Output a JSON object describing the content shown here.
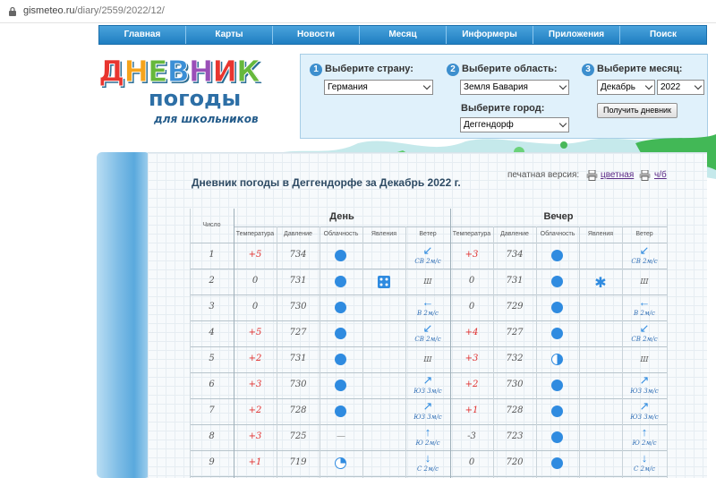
{
  "browser": {
    "url_host": "gismeteo.ru",
    "url_path": "/diary/2559/2022/12/"
  },
  "nav": [
    "Главная",
    "Карты",
    "Новости",
    "Месяц",
    "Информеры",
    "Приложения",
    "Поиск"
  ],
  "logo": {
    "line1": "ДНЕВНИК",
    "line2": "погоды",
    "line3": "для школьников"
  },
  "form": {
    "country_label": "Выберите страну:",
    "country_value": "Германия",
    "region_label": "Выберите область:",
    "region_value": "Земля Бавария",
    "city_label": "Выберите город:",
    "city_value": "Деггендорф",
    "month_label": "Выберите месяц:",
    "month_value": "Декабрь",
    "year_value": "2022",
    "submit_label": "Получить дневник",
    "step1": "1",
    "step2": "2",
    "step3": "3"
  },
  "diary": {
    "title": "Дневник погоды в Деггендорфе за Декабрь 2022 г.",
    "print_label": "печатная версия:",
    "print_color": "цветная",
    "print_bw": "ч/б",
    "col_date": "Число",
    "day_label": "День",
    "evening_label": "Вечер",
    "sub_headers": [
      "Температура",
      "Давление",
      "Облачность",
      "Явления",
      "Ветер",
      "Температура",
      "Давление",
      "Облачность",
      "Явления",
      "Ветер"
    ],
    "rows": [
      {
        "d": "1",
        "t1": "+5",
        "p1": "734",
        "c1": "full",
        "ph1": "",
        "w1a": "↙",
        "w1": "СВ 2м/с",
        "t2": "+3",
        "p2": "734",
        "c2": "full",
        "ph2": "",
        "w2a": "↙",
        "w2": "СВ 2м/с"
      },
      {
        "d": "2",
        "t1": "0",
        "p1": "731",
        "c1": "full",
        "ph1": "dice",
        "w1a": "",
        "w1": "Ш",
        "t2": "0",
        "p2": "731",
        "c2": "full",
        "ph2": "snow",
        "w2a": "",
        "w2": "Ш"
      },
      {
        "d": "3",
        "t1": "0",
        "p1": "730",
        "c1": "full",
        "ph1": "",
        "w1a": "←",
        "w1": "В 2м/с",
        "t2": "0",
        "p2": "729",
        "c2": "full",
        "ph2": "",
        "w2a": "←",
        "w2": "В 2м/с"
      },
      {
        "d": "4",
        "t1": "+5",
        "p1": "727",
        "c1": "full",
        "ph1": "",
        "w1a": "↙",
        "w1": "СВ 2м/с",
        "t2": "+4",
        "p2": "727",
        "c2": "full",
        "ph2": "",
        "w2a": "↙",
        "w2": "СВ 2м/с"
      },
      {
        "d": "5",
        "t1": "+2",
        "p1": "731",
        "c1": "full",
        "ph1": "",
        "w1a": "",
        "w1": "Ш",
        "t2": "+3",
        "p2": "732",
        "c2": "half",
        "ph2": "",
        "w2a": "",
        "w2": "Ш"
      },
      {
        "d": "6",
        "t1": "+3",
        "p1": "730",
        "c1": "full",
        "ph1": "",
        "w1a": "↗",
        "w1": "ЮЗ 3м/с",
        "t2": "+2",
        "p2": "730",
        "c2": "full",
        "ph2": "",
        "w2a": "↗",
        "w2": "ЮЗ 3м/с"
      },
      {
        "d": "7",
        "t1": "+2",
        "p1": "728",
        "c1": "full",
        "ph1": "",
        "w1a": "↗",
        "w1": "ЮЗ 3м/с",
        "t2": "+1",
        "p2": "728",
        "c2": "full",
        "ph2": "",
        "w2a": "↗",
        "w2": "ЮЗ 3м/с"
      },
      {
        "d": "8",
        "t1": "+3",
        "p1": "725",
        "c1": "none",
        "ph1": "",
        "w1a": "↑",
        "w1": "Ю 2м/с",
        "t2": "-3",
        "p2": "723",
        "c2": "full",
        "ph2": "",
        "w2a": "↑",
        "w2": "Ю 2м/с"
      },
      {
        "d": "9",
        "t1": "+1",
        "p1": "719",
        "c1": "quarter",
        "ph1": "",
        "w1a": "↓",
        "w1": "С 2м/с",
        "t2": "0",
        "p2": "720",
        "c2": "full",
        "ph2": "",
        "w2a": "↓",
        "w2": "С 2м/с"
      }
    ]
  },
  "colors": {
    "nav": "#1f7ec1",
    "cloud": "#2f8be0",
    "temp_positive": "#e0302f"
  }
}
